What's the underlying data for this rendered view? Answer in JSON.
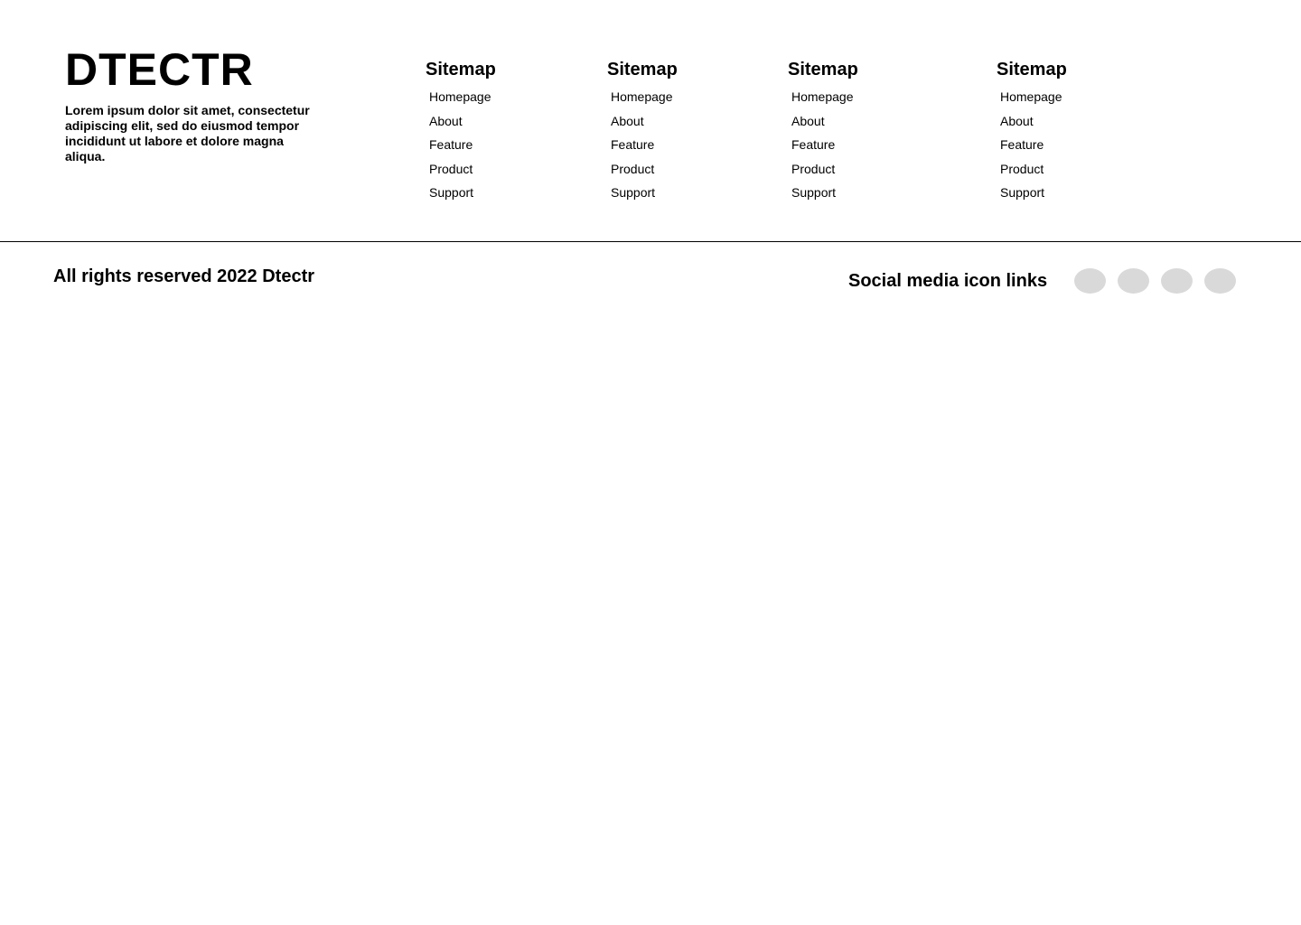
{
  "brand": {
    "logo": "DTECTR",
    "tagline": "Lorem ipsum dolor sit amet, consectetur adipiscing elit, sed do eiusmod tempor incididunt ut labore et dolore magna aliqua."
  },
  "sitemap_columns": [
    {
      "title": "Sitemap",
      "links": [
        "Homepage",
        "About",
        "Feature",
        "Product",
        "Support"
      ]
    },
    {
      "title": "Sitemap",
      "links": [
        "Homepage",
        "About",
        "Feature",
        "Product",
        "Support"
      ]
    },
    {
      "title": "Sitemap",
      "links": [
        "Homepage",
        "About",
        "Feature",
        "Product",
        "Support"
      ]
    },
    {
      "title": "Sitemap",
      "links": [
        "Homepage",
        "About",
        "Feature",
        "Product",
        "Support"
      ]
    }
  ],
  "footer": {
    "copyright": "All rights reserved 2022 Dtectr",
    "social_label": "Social media icon links",
    "social_icons": [
      "social-icon-placeholder",
      "social-icon-placeholder",
      "social-icon-placeholder",
      "social-icon-placeholder"
    ],
    "icon_color": "#d9d9d9"
  }
}
